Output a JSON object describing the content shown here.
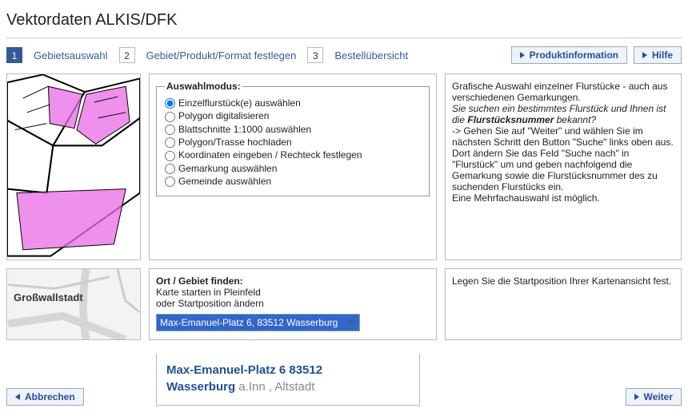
{
  "page": {
    "title": "Vektordaten ALKIS/DFK"
  },
  "steps": {
    "n1": "1",
    "l1": "Gebietsauswahl",
    "n2": "2",
    "l2": "Gebiet/Produkt/Format festlegen",
    "n3": "3",
    "l3": "Bestellübersicht"
  },
  "topBtn": {
    "info": "Produktinformation",
    "help": "Hilfe"
  },
  "modus": {
    "legend": "Auswahlmodus:",
    "o1": "Einzelflurstück(e) auswählen",
    "o2": "Polygon digitalisieren",
    "o3": "Blattschnitte 1:1000 auswählen",
    "o4": "Polygon/Trasse hochladen",
    "o5": "Koordinaten eingeben / Rechteck festlegen",
    "o6": "Gemarkung auswählen",
    "o7": "Gemeinde auswählen"
  },
  "help": {
    "p1": "Grafische Auswahl einzelner Flurstücke - auch aus verschiedenen Gemarkungen.",
    "p2a": "Sie suchen ein bestimmtes Flurstück und Ihnen ist die ",
    "p2b": "Flurstücksnummer",
    "p2c": " bekannt?",
    "p3": "-> Gehen Sie auf \"Weiter\" und wählen Sie im nächsten Schritt den Button \"Suche\" links oben aus. Dort ändern Sie das Feld \"Suche nach\" in \"Flurstück\" um und geben nachfolgend die Gemarkung sowie die Flurstücksnummer des zu suchenden Flurstücks ein.",
    "p4": "Eine Mehrfachauswahl ist möglich."
  },
  "start": {
    "legend": "Ort / Gebiet finden:",
    "l1": "Karte starten in Pleinfeld",
    "l2": "oder Startposition ändern",
    "value": "Max-Emanuel-Platz 6, 83512 Wasserburg",
    "dd1": "Max-Emanuel-Platz 6 83512",
    "dd2a": "Wasserburg",
    "dd2b": " a.Inn , Altstadt",
    "right": "Legen Sie die Startposition Ihrer Kartenansicht fest.",
    "town": "Großwallstadt"
  },
  "nav": {
    "cancel": "Abbrechen",
    "next": "Weiter"
  }
}
